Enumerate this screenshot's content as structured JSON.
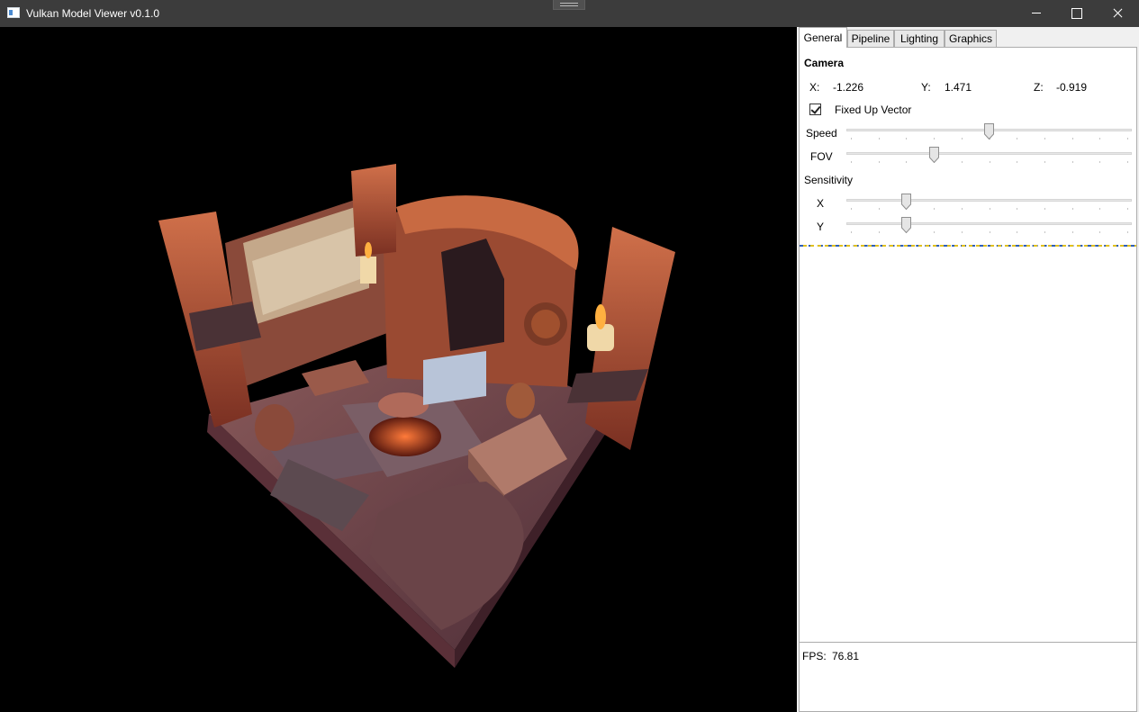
{
  "window": {
    "title": "Vulkan Model Viewer v0.1.0"
  },
  "tabs": [
    "General",
    "Pipeline",
    "Lighting",
    "Graphics"
  ],
  "camera": {
    "title": "Camera",
    "x_label": "X:",
    "x_value": "-1.226",
    "y_label": "Y:",
    "y_value": "1.471",
    "z_label": "Z:",
    "z_value": "-0.919",
    "fixed_up_label": "Fixed Up Vector",
    "fixed_up_checked": true,
    "speed_label": "Speed",
    "speed_fraction": 0.5,
    "fov_label": "FOV",
    "fov_fraction": 0.3,
    "sensitivity_label": "Sensitivity",
    "sens_x_label": "X",
    "sens_x_fraction": 0.2,
    "sens_y_label": "Y",
    "sens_y_fraction": 0.2
  },
  "status": {
    "fps_label": "FPS:",
    "fps_value": "76.81"
  },
  "colors": {
    "titlebar": "#3c3c3c",
    "viewport_bg": "#000000",
    "panel_bg": "#f0f0f0",
    "wood": "#b8553a",
    "stone": "#6a4a4c",
    "fire": "#e8603a"
  }
}
